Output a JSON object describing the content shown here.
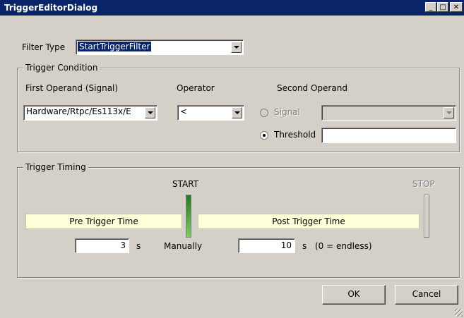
{
  "window": {
    "title": "TriggerEditorDialog"
  },
  "filter": {
    "label": "Filter Type",
    "value": "StartTriggerFilter"
  },
  "condition": {
    "group_title": "Trigger Condition",
    "first_operand_label": "First Operand (Signal)",
    "first_operand_value": "Hardware/Rtpc/Es113x/E",
    "operator_label": "Operator",
    "operator_value": "<",
    "second_operand_label": "Second Operand",
    "signal_option_label": "Signal",
    "threshold_option_label": "Threshold",
    "threshold_value": "",
    "selected_option": "Threshold"
  },
  "timing": {
    "group_title": "Trigger Timing",
    "start_label": "START",
    "stop_label": "STOP",
    "pre_label": "Pre Trigger Time",
    "post_label": "Post Trigger Time",
    "pre_value": "3",
    "pre_unit": "s",
    "manually_label": "Manually",
    "post_value": "10",
    "post_unit": "s",
    "post_hint": "(0 = endless)"
  },
  "buttons": {
    "ok": "OK",
    "cancel": "Cancel"
  },
  "colors": {
    "titlebar": "#0a246a",
    "face": "#d4d0c8",
    "time_box": "#ffffd9",
    "start_bar": "#2f8f2f"
  }
}
